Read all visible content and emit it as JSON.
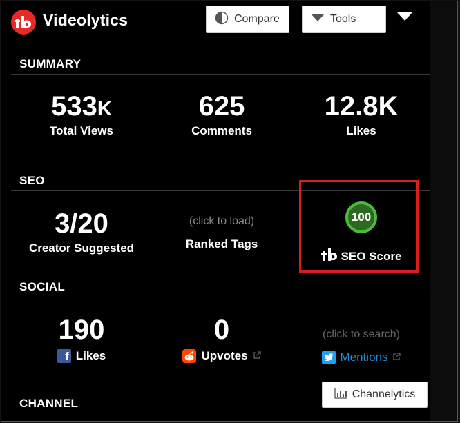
{
  "header": {
    "app_title": "Videolytics",
    "compare_label": "Compare",
    "tools_label": "Tools"
  },
  "summary": {
    "heading": "SUMMARY",
    "total_views": {
      "value": "533",
      "suffix": "K",
      "label": "Total Views"
    },
    "comments": {
      "value": "625",
      "label": "Comments"
    },
    "likes": {
      "value": "12.8K",
      "label": "Likes"
    }
  },
  "seo": {
    "heading": "SEO",
    "creator_suggested": {
      "value": "3/20",
      "label": "Creator Suggested"
    },
    "ranked_tags": {
      "hint": "(click to load)",
      "label": "Ranked Tags"
    },
    "seo_score": {
      "value": "100",
      "label": "SEO Score"
    }
  },
  "social": {
    "heading": "SOCIAL",
    "facebook": {
      "value": "190",
      "label": "Likes"
    },
    "reddit": {
      "value": "0",
      "label": "Upvotes"
    },
    "twitter": {
      "hint": "(click to search)",
      "label": "Mentions"
    }
  },
  "channel": {
    "heading": "CHANNEL",
    "channelytics_label": "Channelytics"
  },
  "colors": {
    "brand_red": "#e62b26",
    "highlight_red": "#d91e1e",
    "score_green": "#4cbb3a",
    "link_blue": "#1f8bd2"
  },
  "icons": {
    "logo": "tubebuddy-logo-icon",
    "compare": "half-circle-icon",
    "tools": "caret-down-icon",
    "seo": "tubebuddy-mark-icon",
    "facebook": "facebook-icon",
    "reddit": "reddit-icon",
    "twitter": "twitter-icon",
    "external": "external-link-icon",
    "channelytics": "bar-chart-icon"
  }
}
